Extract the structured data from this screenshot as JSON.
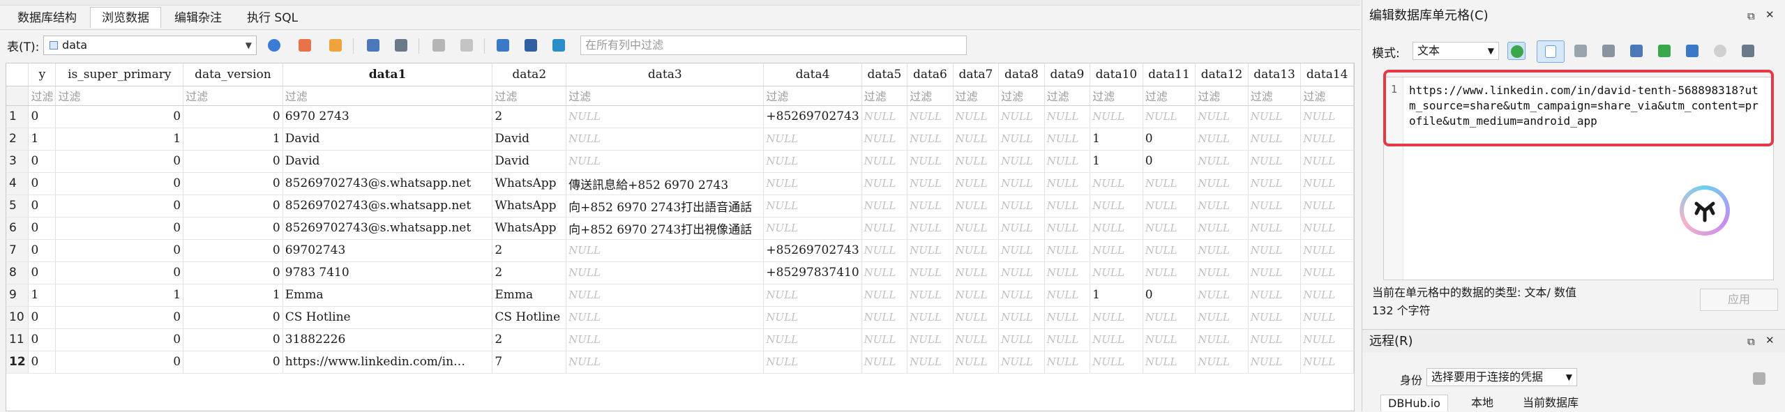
{
  "tabs": [
    {
      "label": "数据库结构",
      "active": false
    },
    {
      "label": "浏览数据",
      "active": true
    },
    {
      "label": "编辑杂注",
      "active": false
    },
    {
      "label": "执行 SQL",
      "active": false
    }
  ],
  "toolbar": {
    "table_label": "表(T):",
    "table_value": "data",
    "filter_placeholder": "在所有列中过滤"
  },
  "grid": {
    "columns": [
      "y",
      "is_super_primary",
      "data_version",
      "data1",
      "data2",
      "data3",
      "data4",
      "data5",
      "data6",
      "data7",
      "data8",
      "data9",
      "data10",
      "data11",
      "data12",
      "data13",
      "data14"
    ],
    "filter_text": "过滤",
    "null_text": "NULL",
    "rows": [
      {
        "n": "1",
        "cells": [
          "0",
          "0",
          "0",
          "6970 2743",
          "2",
          null,
          "+85269702743",
          null,
          null,
          null,
          null,
          null,
          null,
          null,
          null,
          null,
          null
        ]
      },
      {
        "n": "2",
        "cells": [
          "1",
          "1",
          "1",
          "David",
          "David",
          null,
          null,
          null,
          null,
          null,
          null,
          null,
          "1",
          "0",
          null,
          null,
          null
        ]
      },
      {
        "n": "3",
        "cells": [
          "0",
          "0",
          "0",
          "David",
          "David",
          null,
          null,
          null,
          null,
          null,
          null,
          null,
          "1",
          "0",
          null,
          null,
          null
        ]
      },
      {
        "n": "4",
        "cells": [
          "0",
          "0",
          "0",
          "85269702743@s.whatsapp.net",
          "WhatsApp",
          "傳送訊息給+852 6970 2743",
          null,
          null,
          null,
          null,
          null,
          null,
          null,
          null,
          null,
          null,
          null
        ]
      },
      {
        "n": "5",
        "cells": [
          "0",
          "0",
          "0",
          "85269702743@s.whatsapp.net",
          "WhatsApp",
          "向+852 6970 2743打出語音通話",
          null,
          null,
          null,
          null,
          null,
          null,
          null,
          null,
          null,
          null,
          null
        ]
      },
      {
        "n": "6",
        "cells": [
          "0",
          "0",
          "0",
          "85269702743@s.whatsapp.net",
          "WhatsApp",
          "向+852 6970 2743打出視像通話",
          null,
          null,
          null,
          null,
          null,
          null,
          null,
          null,
          null,
          null,
          null
        ]
      },
      {
        "n": "7",
        "cells": [
          "0",
          "0",
          "0",
          "69702743",
          "2",
          null,
          "+85269702743",
          null,
          null,
          null,
          null,
          null,
          null,
          null,
          null,
          null,
          null
        ]
      },
      {
        "n": "8",
        "cells": [
          "0",
          "0",
          "0",
          "9783 7410",
          "2",
          null,
          "+85297837410",
          null,
          null,
          null,
          null,
          null,
          null,
          null,
          null,
          null,
          null
        ]
      },
      {
        "n": "9",
        "cells": [
          "1",
          "1",
          "1",
          "Emma",
          "Emma",
          null,
          null,
          null,
          null,
          null,
          null,
          null,
          "1",
          "0",
          null,
          null,
          null
        ]
      },
      {
        "n": "10",
        "cells": [
          "0",
          "0",
          "0",
          "CS Hotline",
          "CS Hotline",
          null,
          null,
          null,
          null,
          null,
          null,
          null,
          null,
          null,
          null,
          null,
          null
        ]
      },
      {
        "n": "11",
        "cells": [
          "0",
          "0",
          "0",
          "31882226",
          "2",
          null,
          null,
          null,
          null,
          null,
          null,
          null,
          null,
          null,
          null,
          null,
          null
        ]
      },
      {
        "n": "12",
        "cells": [
          "0",
          "0",
          "0",
          "https://www.linkedin.com/in…",
          "7",
          null,
          null,
          null,
          null,
          null,
          null,
          null,
          null,
          null,
          null,
          null,
          null
        ]
      }
    ]
  },
  "editor": {
    "title": "编辑数据库单元格(C)",
    "mode_label": "模式:",
    "mode_value": "文本",
    "line_no": "1",
    "content": "https://www.linkedin.com/in/david-tenth-568898318?utm_source=share&utm_campaign=share_via&utm_content=profile&utm_medium=android_app",
    "type_info": "当前在单元格中的数据的类型: 文本/ 数值",
    "char_count": "132 个字符",
    "apply_label": "应用"
  },
  "remote": {
    "title": "远程(R)",
    "identity_label": "身份",
    "identity_value": "选择要用于连接的凭据",
    "tabs": [
      "DBHub.io",
      "本地",
      "当前数据库"
    ]
  },
  "colors": {
    "highlight": "#e63946",
    "accent": "#5b8cc9"
  }
}
